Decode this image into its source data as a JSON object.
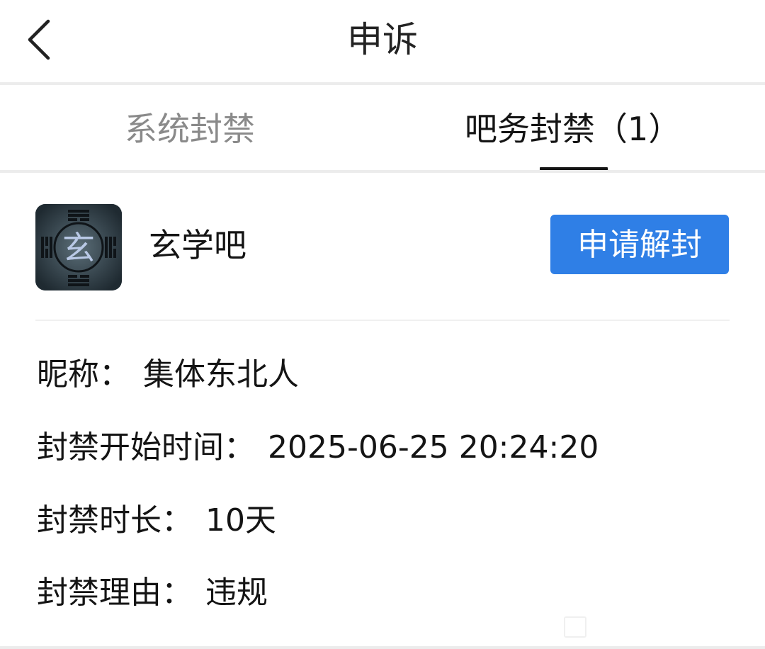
{
  "header": {
    "back_icon": "chevron-left-icon",
    "title": "申诉"
  },
  "tabs": [
    {
      "label": "系统封禁",
      "active": false
    },
    {
      "label": "吧务封禁（1）",
      "active": true
    }
  ],
  "ban_card": {
    "forum_avatar_glyph": "玄",
    "forum_name": "玄学吧",
    "appeal_button_label": "申请解封",
    "nickname_label": "昵称",
    "nickname_value": "集体东北人",
    "start_time_label": "封禁开始时间",
    "start_time_value": "2025-06-25 20:24:20",
    "duration_label": "封禁时长",
    "duration_value": "10天",
    "reason_label": "封禁理由",
    "reason_value": "违规",
    "separator": "："
  },
  "colors": {
    "accent": "#2f7fe6",
    "text_primary": "#141414",
    "text_inactive": "#8a8a8a",
    "divider": "#ececec"
  }
}
